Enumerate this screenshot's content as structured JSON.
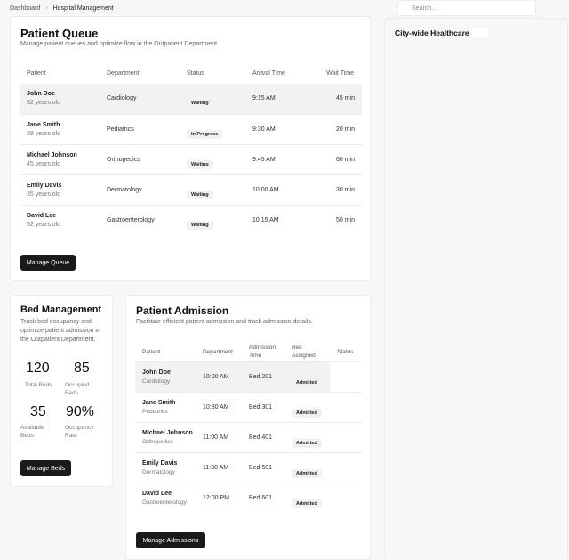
{
  "breadcrumb": {
    "root": "Dashboard",
    "separator": "›",
    "current": "Hospital Management"
  },
  "search": {
    "placeholder": "Search..."
  },
  "city": {
    "title": "City-wide Healthcare"
  },
  "queue": {
    "title": "Patient Queue",
    "subtitle": "Manage patient queues and optimize flow in the Outpatient Department.",
    "columns": [
      "Patient",
      "Department",
      "Status",
      "Arrival Time",
      "Wait Time"
    ],
    "rows": [
      {
        "name": "John Doe",
        "age": "32 years old",
        "dept": "Cardiology",
        "status": "Waiting",
        "arrival": "9:15 AM",
        "wait": "45 min"
      },
      {
        "name": "Jane Smith",
        "age": "28 years old",
        "dept": "Pediatrics",
        "status": "In Progress",
        "arrival": "9:30 AM",
        "wait": "20 min"
      },
      {
        "name": "Michael Johnson",
        "age": "45 years old",
        "dept": "Orthopedics",
        "status": "Waiting",
        "arrival": "9:45 AM",
        "wait": "60 min"
      },
      {
        "name": "Emily Davis",
        "age": "35 years old",
        "dept": "Dermatology",
        "status": "Waiting",
        "arrival": "10:00 AM",
        "wait": "30 min"
      },
      {
        "name": "David Lee",
        "age": "52 years old",
        "dept": "Gastroenterology",
        "status": "Waiting",
        "arrival": "10:15 AM",
        "wait": "50 min"
      }
    ],
    "button": "Manage Queue"
  },
  "beds": {
    "title": "Bed Management",
    "subtitle": "Track bed occupancy and optimize patient admission in the Outpatient Department.",
    "stats": [
      {
        "value": "120",
        "label": "Total Beds"
      },
      {
        "value": "85",
        "label": "Occupied Beds"
      },
      {
        "value": "35",
        "label": "Available Beds"
      },
      {
        "value": "90%",
        "label": "Occupancy Rate"
      }
    ],
    "button": "Manage Beds"
  },
  "admission": {
    "title": "Patient Admission",
    "subtitle": "Facilitate efficient patient admission and track admission details.",
    "columns": [
      "Patient",
      "Department",
      "Admission Time",
      "Bed Assigned",
      "Status"
    ],
    "rows": [
      {
        "name": "John Doe",
        "dept": "Cardiology",
        "time": "10:00 AM",
        "bed": "Bed 201",
        "status": "Admitted"
      },
      {
        "name": "Jane Smith",
        "dept": "Pediatrics",
        "time": "10:30 AM",
        "bed": "Bed 301",
        "status": "Admitted"
      },
      {
        "name": "Michael Johnson",
        "dept": "Orthopedics",
        "time": "11:00 AM",
        "bed": "Bed 401",
        "status": "Admitted"
      },
      {
        "name": "Emily Davis",
        "dept": "Dermatology",
        "time": "11:30 AM",
        "bed": "Bed 501",
        "status": "Admitted"
      },
      {
        "name": "David Lee",
        "dept": "Gastroenterology",
        "time": "12:00 PM",
        "bed": "Bed 601",
        "status": "Admitted"
      }
    ],
    "button": "Manage Admissions"
  }
}
